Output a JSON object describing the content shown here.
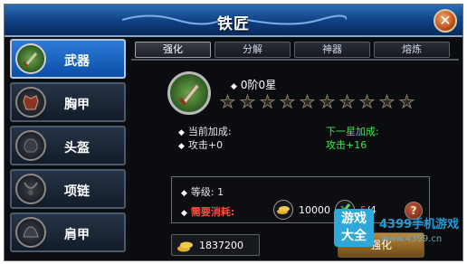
{
  "window": {
    "title": "铁匠",
    "close_icon": "close-icon"
  },
  "sidebar": {
    "items": [
      {
        "label": "武器",
        "icon": "sword-icon",
        "active": true
      },
      {
        "label": "胸甲",
        "icon": "chest-armor-icon",
        "active": false
      },
      {
        "label": "头盔",
        "icon": "helmet-icon",
        "active": false
      },
      {
        "label": "项链",
        "icon": "necklace-icon",
        "active": false
      },
      {
        "label": "肩甲",
        "icon": "shoulder-armor-icon",
        "active": false
      }
    ]
  },
  "tabs": [
    {
      "label": "强化",
      "active": true
    },
    {
      "label": "分解",
      "active": false
    },
    {
      "label": "神器",
      "active": false
    },
    {
      "label": "熔炼",
      "active": false
    }
  ],
  "item": {
    "stage": "0阶0星",
    "stars_total": 10,
    "stars_filled": 0,
    "current_bonus_label": "当前加成:",
    "current_bonus_value": "攻击+0",
    "next_bonus_label": "下一星加成:",
    "next_bonus_value": "攻击+16"
  },
  "cost": {
    "level_label": "等级: 1",
    "need_label": "需要消耗:",
    "gold_amount": "10000",
    "material_have": "5",
    "material_need": "/4",
    "help_label": "?"
  },
  "player": {
    "gold": "1837200"
  },
  "buttons": {
    "enhance": "强化"
  },
  "watermark": {
    "logo_line1": "游戏",
    "logo_line2": "大全",
    "brand": "4399手机游戏",
    "url": "www.4399.cn"
  },
  "colors": {
    "accent_blue": "#0b4ea8",
    "green_text": "#3ee84f",
    "red_text": "#ff4a3c"
  }
}
